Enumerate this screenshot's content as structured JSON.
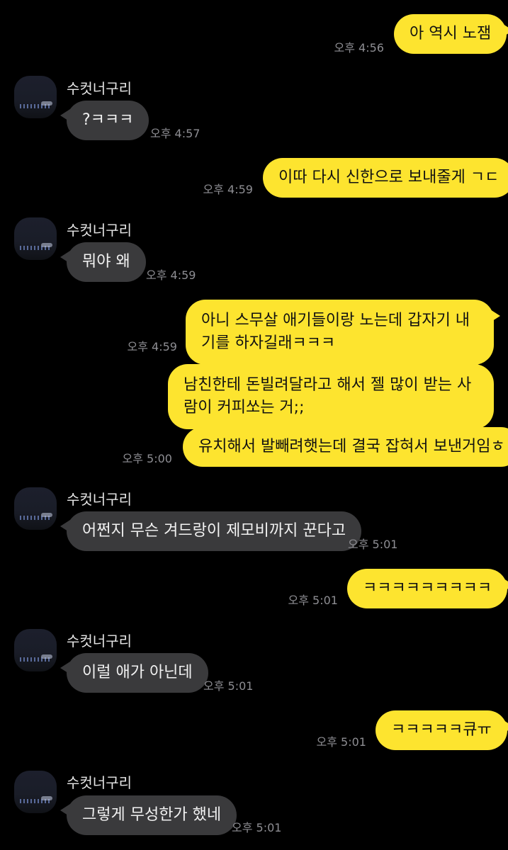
{
  "contact": {
    "name": "수컷너구리"
  },
  "colors": {
    "background": "#000000",
    "sent_bubble": "#FDE42F",
    "received_bubble": "#3a3a3c",
    "timestamp": "#8e8e93"
  },
  "messages": [
    {
      "side": "sent",
      "text": "아 역시 노잼",
      "time": "오후 4:56"
    },
    {
      "side": "received",
      "text": "?ㅋㅋㅋ",
      "time": "오후 4:57"
    },
    {
      "side": "sent",
      "text": "이따 다시 신한으로 보내줄게 ㄱㄷ",
      "time": "오후 4:59"
    },
    {
      "side": "received",
      "text": "뭐야 왜",
      "time": "오후 4:59"
    },
    {
      "side": "sent",
      "text": "아니 스무살 애기들이랑 노는데 갑자기 내기를 하자길래ㅋㅋㅋ",
      "time": "오후 4:59"
    },
    {
      "side": "sent",
      "text": "남친한테 돈빌려달라고 해서 젤 많이 받는 사람이 커피쏘는 거;;",
      "time": ""
    },
    {
      "side": "sent",
      "text": "유치해서 발빼려햇는데 결국 잡혀서 보낸거임ㅎ",
      "time": "오후 5:00"
    },
    {
      "side": "received",
      "text": "어쩐지 무슨 겨드랑이 제모비까지 꾼다고",
      "time": "오후 5:01"
    },
    {
      "side": "sent",
      "text": "ㅋㅋㅋㅋㅋㅋㅋㅋㅋ",
      "time": "오후 5:01"
    },
    {
      "side": "received",
      "text": "이럴 애가 아닌데",
      "time": "오후 5:01"
    },
    {
      "side": "sent",
      "text": "ㅋㅋㅋㅋㅋ큐ㅠ",
      "time": "오후 5:01"
    },
    {
      "side": "received",
      "text": "그렇게 무성한가 했네",
      "time": "오후 5:01"
    }
  ]
}
